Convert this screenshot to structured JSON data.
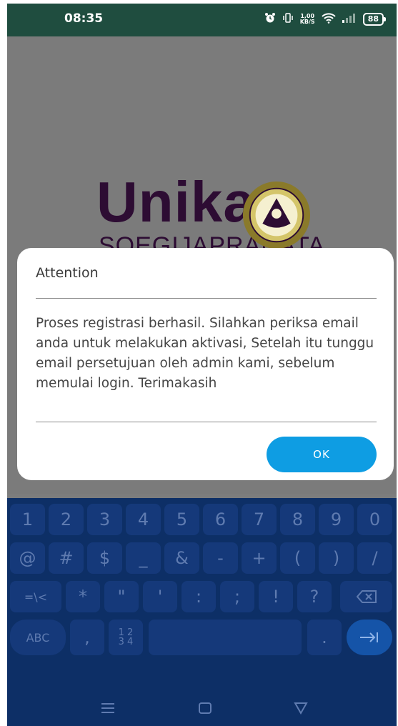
{
  "status_bar": {
    "time": "08:35",
    "net_speed_top": "1,00",
    "net_speed_bottom": "KB/S",
    "battery": "88"
  },
  "app": {
    "logo_main": "Unika",
    "logo_sub": "SOEGIJAPRANATA"
  },
  "dialog": {
    "title": "Attention",
    "message": "Proses registrasi berhasil. Silahkan periksa email anda untuk melakukan aktivasi, Setelah itu tunggu email persetujuan oleh admin kami, sebelum memulai login. Terimakasih",
    "ok_label": "OK"
  },
  "keyboard": {
    "row1": [
      "1",
      "2",
      "3",
      "4",
      "5",
      "6",
      "7",
      "8",
      "9",
      "0"
    ],
    "row2": [
      "@",
      "#",
      "$",
      "_",
      "&",
      "-",
      "+",
      "(",
      ")",
      "/"
    ],
    "row3": [
      "=\\<",
      "*",
      "\"",
      "'",
      ":",
      ";",
      "!",
      "?"
    ],
    "row4": {
      "abc": "ABC",
      "comma": ",",
      "numpad_top": "1 2",
      "numpad_bottom": "3 4",
      "period": "."
    }
  },
  "icons": {
    "alarm": "alarm-icon",
    "vibrate": "vibrate-icon",
    "wifi": "wifi-icon",
    "signal": "signal-icon",
    "backspace": "backspace-icon",
    "enter": "enter-arrow-icon",
    "nav_menu": "menu-icon",
    "nav_home": "home-icon",
    "nav_back": "back-triangle-icon"
  },
  "colors": {
    "status_bar": "#1f4d3f",
    "ok_button": "#0e9de3",
    "keyboard_bg": "#0d2f66",
    "logo": "#2d0c33"
  }
}
